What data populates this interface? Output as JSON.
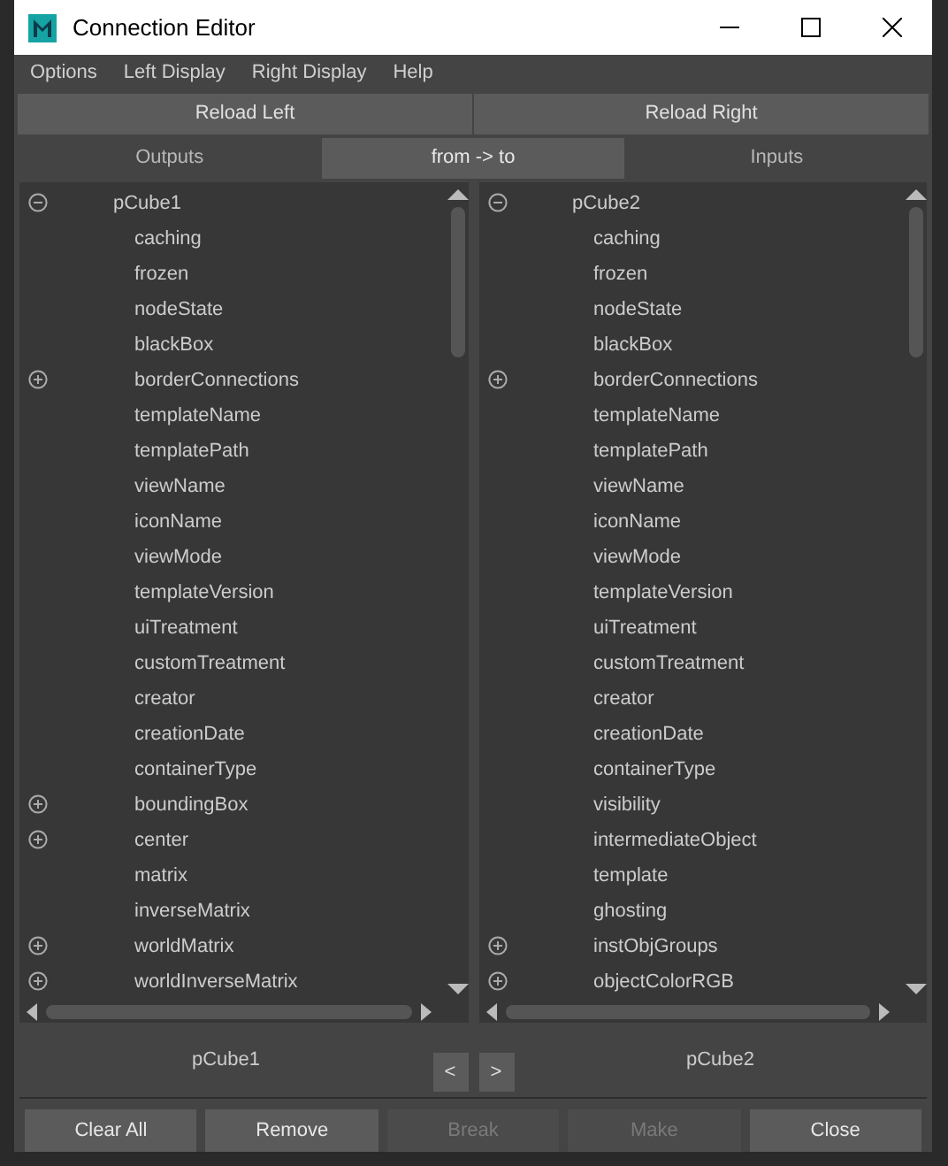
{
  "window": {
    "title": "Connection Editor"
  },
  "menu": [
    "Options",
    "Left Display",
    "Right Display",
    "Help"
  ],
  "reload_buttons": [
    "Reload Left",
    "Reload Right"
  ],
  "tabs": [
    {
      "label": "Outputs",
      "selected": false
    },
    {
      "label": "from -> to",
      "selected": true
    },
    {
      "label": "Inputs",
      "selected": false
    }
  ],
  "lists": [
    {
      "node": "pCube1",
      "expanded": true,
      "attributes": [
        {
          "name": "caching"
        },
        {
          "name": "frozen"
        },
        {
          "name": "nodeState"
        },
        {
          "name": "blackBox"
        },
        {
          "name": "borderConnections",
          "expanded": false
        },
        {
          "name": "templateName"
        },
        {
          "name": "templatePath"
        },
        {
          "name": "viewName"
        },
        {
          "name": "iconName"
        },
        {
          "name": "viewMode"
        },
        {
          "name": "templateVersion"
        },
        {
          "name": "uiTreatment"
        },
        {
          "name": "customTreatment"
        },
        {
          "name": "creator"
        },
        {
          "name": "creationDate"
        },
        {
          "name": "containerType"
        },
        {
          "name": "boundingBox",
          "expanded": false
        },
        {
          "name": "center",
          "expanded": false
        },
        {
          "name": "matrix"
        },
        {
          "name": "inverseMatrix"
        },
        {
          "name": "worldMatrix",
          "expanded": false
        },
        {
          "name": "worldInverseMatrix",
          "expanded": false
        }
      ]
    },
    {
      "node": "pCube2",
      "expanded": true,
      "attributes": [
        {
          "name": "caching"
        },
        {
          "name": "frozen"
        },
        {
          "name": "nodeState"
        },
        {
          "name": "blackBox"
        },
        {
          "name": "borderConnections",
          "expanded": false
        },
        {
          "name": "templateName"
        },
        {
          "name": "templatePath"
        },
        {
          "name": "viewName"
        },
        {
          "name": "iconName"
        },
        {
          "name": "viewMode"
        },
        {
          "name": "templateVersion"
        },
        {
          "name": "uiTreatment"
        },
        {
          "name": "customTreatment"
        },
        {
          "name": "creator"
        },
        {
          "name": "creationDate"
        },
        {
          "name": "containerType"
        },
        {
          "name": "visibility"
        },
        {
          "name": "intermediateObject"
        },
        {
          "name": "template"
        },
        {
          "name": "ghosting"
        },
        {
          "name": "instObjGroups",
          "expanded": false
        },
        {
          "name": "objectColorRGB",
          "expanded": false
        }
      ]
    }
  ],
  "selection": {
    "left": "pCube1",
    "right": "pCube2"
  },
  "nav_buttons": [
    "<",
    ">"
  ],
  "actions": [
    {
      "label": "Clear All",
      "disabled": false
    },
    {
      "label": "Remove",
      "disabled": false
    },
    {
      "label": "Break",
      "disabled": true
    },
    {
      "label": "Make",
      "disabled": true
    },
    {
      "label": "Close",
      "disabled": false
    }
  ]
}
